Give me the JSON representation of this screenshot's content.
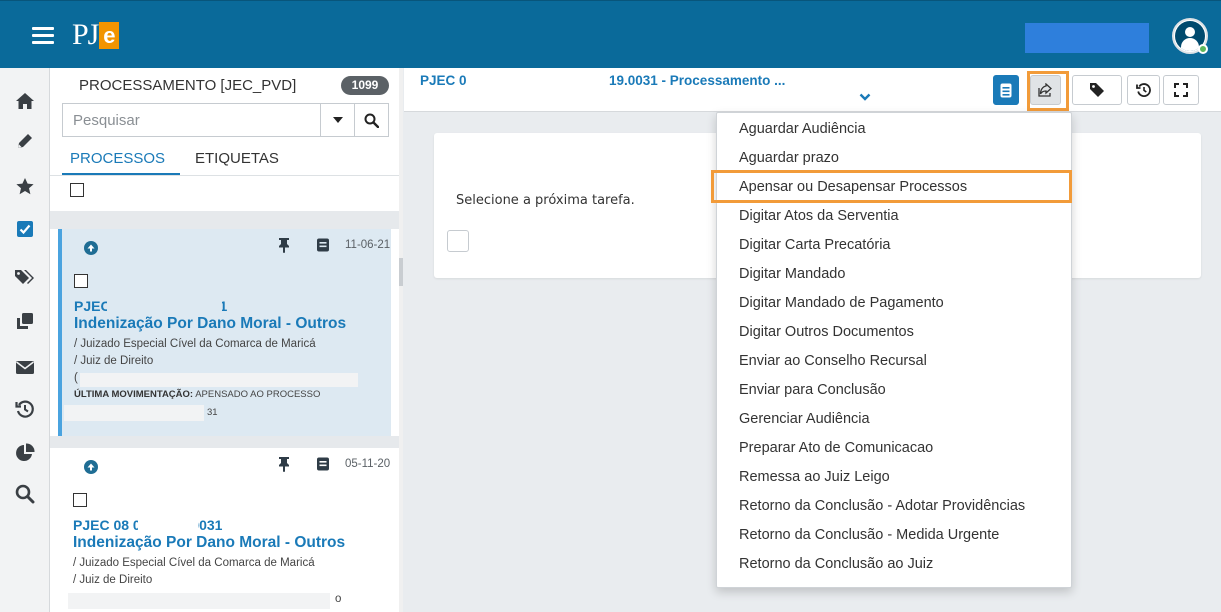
{
  "app": {
    "logo_text": "PJ",
    "logo_accent": "e"
  },
  "list": {
    "title": "PROCESSAMENTO [JEC_PVD]",
    "count": "1099",
    "search_placeholder": "Pesquisar",
    "tabs": [
      {
        "label": "PROCESSOS",
        "active": true
      },
      {
        "label": "ETIQUETAS",
        "active": false
      }
    ],
    "cards": [
      {
        "date": "11-06-21",
        "process_number": "PJEC 0           .2021.8.19.0031",
        "class": "Indenização Por Dano Moral - Outros",
        "court": "/ Juizado Especial Cível da Comarca de Maricá",
        "judge": "/ Juiz de Direito",
        "line3": "(",
        "movement_label": "ÚLTIMA MOVIMENTAÇÃO:",
        "movement_text": "APENSADO AO PROCESSO",
        "movement_suffix": "31"
      },
      {
        "date": "05-11-20",
        "process_number": "PJEC 08           020.8.19.0031",
        "class": "Indenização Por Dano Moral - Outros",
        "court": "/ Juizado Especial Cível da Comarca de Maricá",
        "judge": "/ Juiz de Direito",
        "line3": "o"
      }
    ]
  },
  "main": {
    "title_left": "PJEC 0",
    "title_right": "19.0031 - Processamento ...",
    "task_prompt": "Selecione a próxima tarefa."
  },
  "menu": {
    "items": [
      "Aguardar Audiência",
      "Aguardar prazo",
      "Apensar ou Desapensar Processos",
      "Digitar Atos da Serventia",
      "Digitar Carta Precatória",
      "Digitar Mandado",
      "Digitar Mandado de Pagamento",
      "Digitar Outros Documentos",
      "Enviar ao Conselho Recursal",
      "Enviar para Conclusão",
      "Gerenciar Audiência",
      "Preparar Ato de Comunicacao",
      "Remessa ao Juiz Leigo",
      "Retorno da Conclusão - Adotar Providências",
      "Retorno da Conclusão - Medida Urgente",
      "Retorno da Conclusão ao Juiz"
    ],
    "highlighted_index": 2
  },
  "colors": {
    "header": "#0a6a9a",
    "accent": "#1a7ab8",
    "highlight": "#f29b39",
    "logo_accent": "#f29400"
  }
}
